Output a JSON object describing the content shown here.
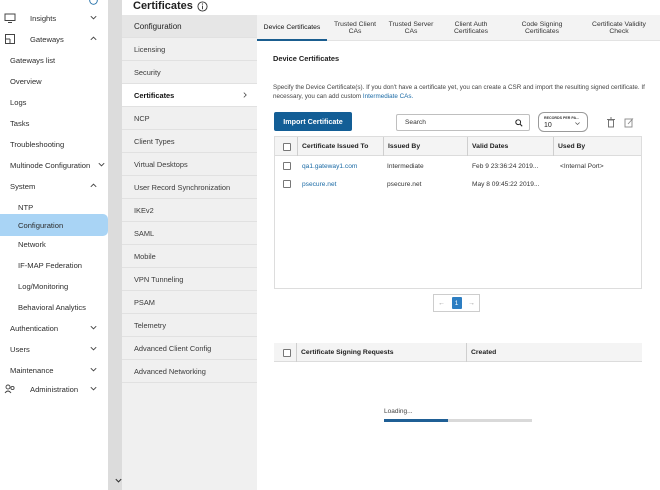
{
  "nav": {
    "items": [
      {
        "label": "Insights",
        "icon": "monitor-icon",
        "chevron": "down"
      },
      {
        "label": "Gateways",
        "icon": "gateway-icon",
        "chevron": "up"
      },
      {
        "label": "Gateways list"
      },
      {
        "label": "Overview"
      },
      {
        "label": "Logs"
      },
      {
        "label": "Tasks"
      },
      {
        "label": "Troubleshooting"
      },
      {
        "label": "Multinode Configuration",
        "chevron": "down"
      },
      {
        "label": "System",
        "chevron": "up"
      },
      {
        "label": "NTP"
      },
      {
        "label": "Configuration",
        "active": true
      },
      {
        "label": "Network"
      },
      {
        "label": "IF-MAP Federation"
      },
      {
        "label": "Log/Monitoring"
      },
      {
        "label": "Behavioral Analytics"
      },
      {
        "label": "Authentication",
        "chevron": "down"
      },
      {
        "label": "Users",
        "chevron": "down"
      },
      {
        "label": "Maintenance",
        "chevron": "down"
      },
      {
        "label": "Administration",
        "icon": "admin-icon",
        "chevron": "down"
      }
    ]
  },
  "page": {
    "title": "Certificates",
    "info_icon": "info-icon"
  },
  "submenu": {
    "header": "Configuration",
    "items": [
      "Licensing",
      "Security",
      "Certificates",
      "NCP",
      "Client Types",
      "Virtual Desktops",
      "User Record Synchronization",
      "IKEv2",
      "SAML",
      "Mobile",
      "VPN Tunneling",
      "PSAM",
      "Telemetry",
      "Advanced Client Config",
      "Advanced Networking"
    ],
    "active": "Certificates"
  },
  "tabs": [
    {
      "label": "Device Certificates",
      "active": true
    },
    {
      "label": "Trusted Client CAs"
    },
    {
      "label": "Trusted Server CAs"
    },
    {
      "label": "Client Auth Certificates"
    },
    {
      "label": "Code Signing Certificates"
    },
    {
      "label": "Certificate Validity Check"
    }
  ],
  "device": {
    "section_title": "Device Certificates",
    "desc_main": "Specify the Device Certificate(s). If you don't have a certificate yet, you can create a CSR and import the resulting signed certificate. If necessary, you can add custom",
    "desc_link": "Intermediate CAs.",
    "import_label": "Import Certificate",
    "search_placeholder": "Search",
    "rpp_label": "RECORDS PER PA...",
    "rpp_value": "10",
    "columns": [
      "Certificate Issued To",
      "Issued By",
      "Valid Dates",
      "Used By"
    ],
    "rows": [
      {
        "issued_to": "qa1.gateway1.com",
        "issued_by": "Intermediate",
        "valid": "Feb 9 23:36:24 2019...",
        "used_by": "<Internal Port>"
      },
      {
        "issued_to": "psecure.net",
        "issued_by": "psecure.net",
        "valid": "May 8 09:45:22 2019...",
        "used_by": ""
      }
    ],
    "page_current": "1"
  },
  "csr": {
    "columns": [
      "Certificate Signing Requests",
      "Created"
    ]
  },
  "loading": {
    "text": "Loading...",
    "progress": 0.43
  },
  "colors": {
    "accent": "#135e96",
    "active_nav": "#a9d4f5",
    "link": "#1a6aa5"
  }
}
